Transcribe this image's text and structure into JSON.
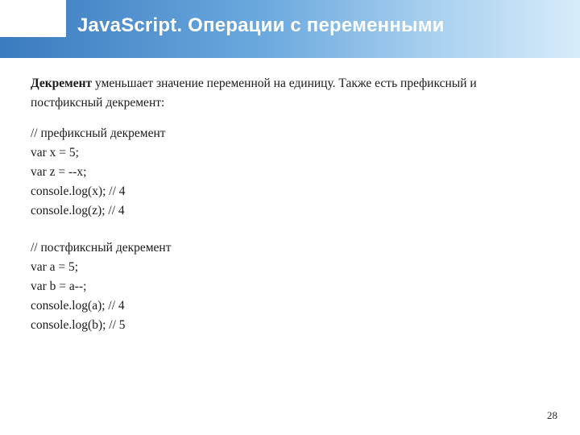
{
  "header": {
    "title": "JavaScript. Операции с переменными"
  },
  "content": {
    "intro_bold": "Декремент",
    "intro_rest": " уменьшает значение переменной на единицу. Также есть префиксный и постфиксный декремент:",
    "block1": {
      "comment": "// префиксный декремент",
      "l1": "var x = 5;",
      "l2": "var z = --x;",
      "l3": "console.log(x); // 4",
      "l4": "console.log(z); // 4"
    },
    "block2": {
      "comment": "// постфиксный декремент",
      "l1": "var a = 5;",
      "l2": "var b = a--;",
      "l3": "console.log(a); // 4",
      "l4": "console.log(b); // 5"
    }
  },
  "page_number": "28"
}
